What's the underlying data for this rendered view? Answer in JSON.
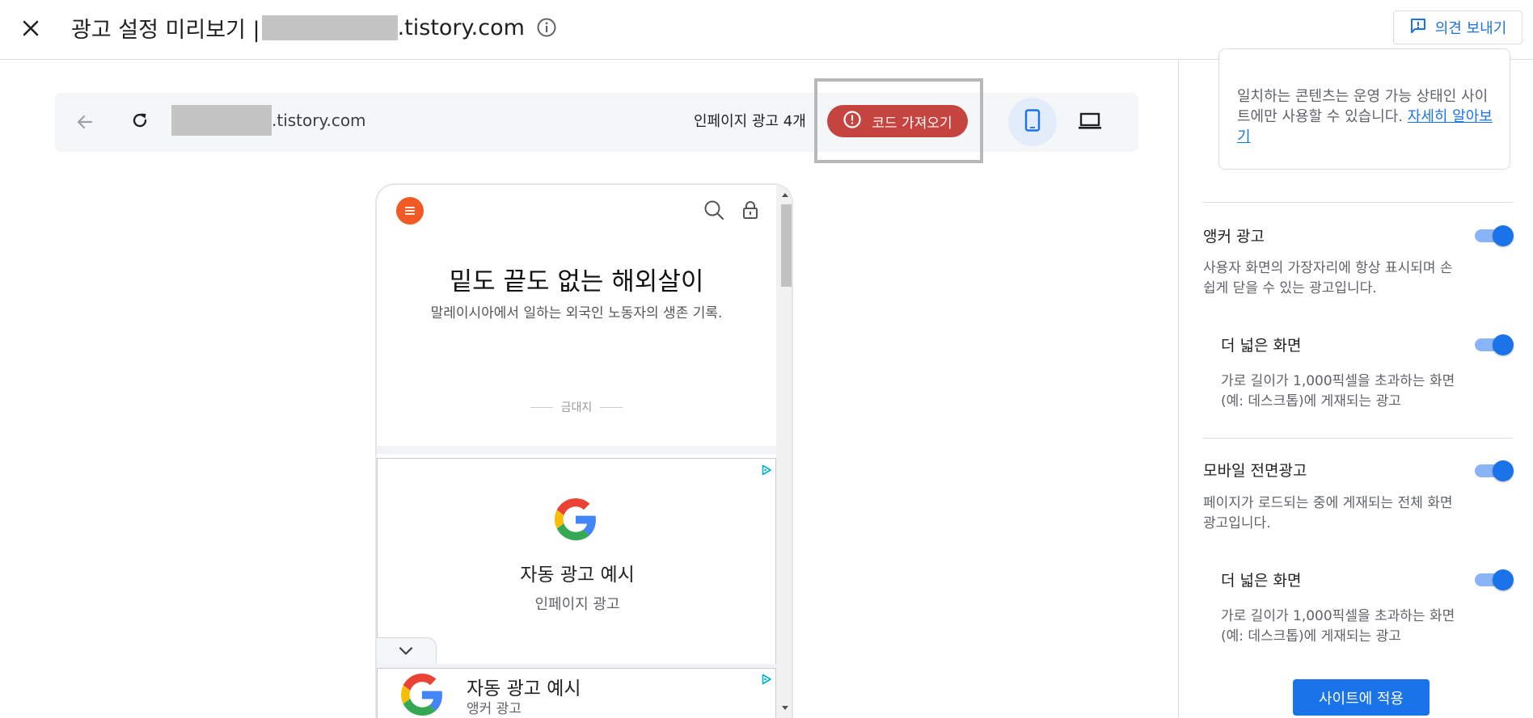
{
  "header": {
    "title_prefix": "광고 설정 미리보기 |",
    "title_domain": ".tistory.com",
    "feedback_label": "의견 보내기"
  },
  "browser": {
    "url_domain": ".tistory.com",
    "inpage_ads_count": "인페이지 광고 4개",
    "get_code_label": "코드 가져오기"
  },
  "preview": {
    "blog_title": "밑도 끝도 없는 해외살이",
    "blog_subtitle": "말레이시아에서 일하는 외국인 노동자의 생존 기록.",
    "category": "금대지",
    "ad_inpage": {
      "title": "자동 광고 예시",
      "type": "인페이지 광고"
    },
    "ad_anchor": {
      "title": "자동 광고 예시",
      "type": "앵커 광고"
    }
  },
  "panel": {
    "notice_text": "일치하는 콘텐츠는 운영 가능 상태인 사이트에만 사용할 수 있습니다. ",
    "notice_link": "자세히 알아보기",
    "anchor": {
      "label": "앵커 광고",
      "desc": "사용자 화면의 가장자리에 항상 표시되며 손쉽게 닫을 수 있는 광고입니다.",
      "enabled": true,
      "wide": {
        "label": "더 넓은 화면",
        "desc": "가로 길이가 1,000픽셀을 초과하는 화면(예: 데스크톱)에 게재되는 광고",
        "enabled": true
      }
    },
    "vignette": {
      "label": "모바일 전면광고",
      "desc": "페이지가 로드되는 중에 게재되는 전체 화면 광고입니다.",
      "enabled": true,
      "wide": {
        "label": "더 넓은 화면",
        "desc": "가로 길이가 1,000픽셀을 초과하는 화면(예: 데스크톱)에 게재되는 광고",
        "enabled": true
      }
    },
    "apply_label": "사이트에 적용"
  },
  "colors": {
    "accent": "#1a73e8",
    "warning_button": "#c5443f",
    "blog_menu": "#f15a24"
  },
  "icons": [
    "close-icon",
    "info-icon",
    "feedback-icon",
    "back-arrow-icon",
    "reload-icon",
    "warning-icon",
    "smartphone-icon",
    "laptop-icon",
    "menu-icon",
    "search-icon",
    "lock-icon",
    "adchoices-icon",
    "google-logo",
    "chevron-down-icon"
  ]
}
